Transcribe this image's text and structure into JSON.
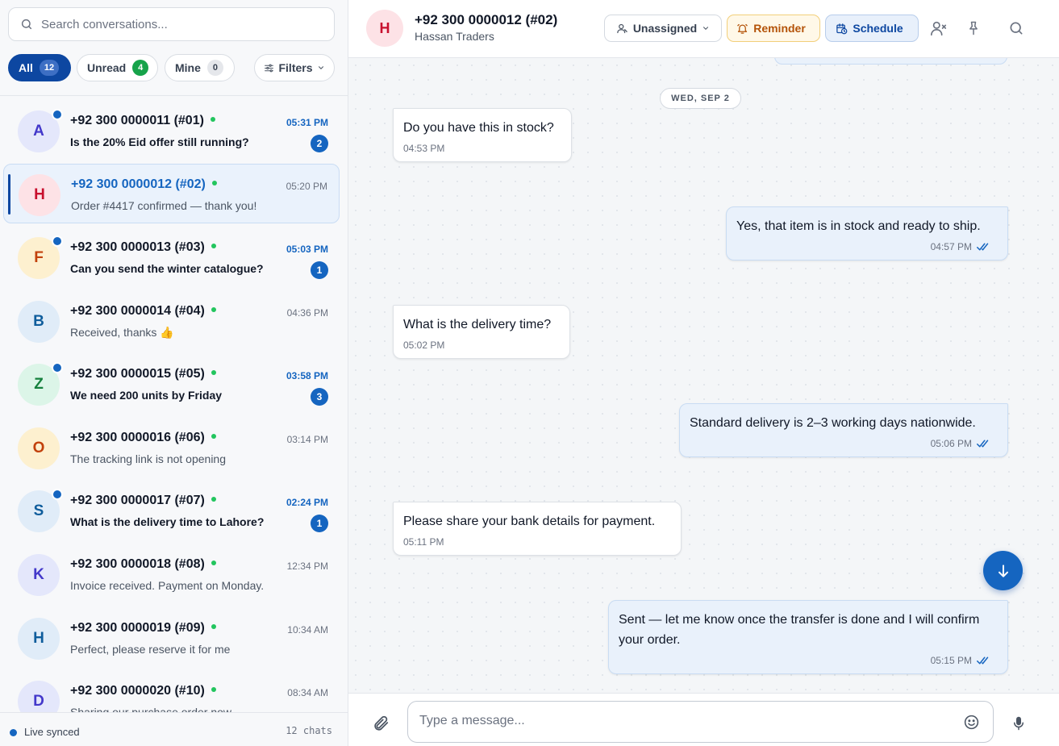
{
  "sidebar": {
    "search": {
      "placeholder": "Search conversations..."
    },
    "filters": {
      "all": {
        "label": "All",
        "count": "12"
      },
      "unread": {
        "label": "Unread",
        "count": "4"
      },
      "mine": {
        "label": "Mine",
        "count": "0"
      },
      "more": {
        "label": "Filters"
      }
    },
    "conversations": [
      {
        "initial": "A",
        "name": "+92 300 0000011 (#01)",
        "preview": "Is the 20% Eid offer still running?",
        "time": "05:31 PM",
        "unread_count": "2",
        "unread": true,
        "active": false,
        "avatar_bg": "#e4e7fb",
        "avatar_fg": "#4338ca"
      },
      {
        "initial": "H",
        "name": "+92 300 0000012 (#02)",
        "preview": "Order #4417 confirmed — thank you!",
        "time": "05:20 PM",
        "unread_count": "",
        "unread": false,
        "active": true,
        "avatar_bg": "#fde2e6",
        "avatar_fg": "#c8102e"
      },
      {
        "initial": "F",
        "name": "+92 300 0000013 (#03)",
        "preview": "Can you send the winter catalogue?",
        "time": "05:03 PM",
        "unread_count": "1",
        "unread": true,
        "active": false,
        "avatar_bg": "#fdf0cf",
        "avatar_fg": "#c2410c"
      },
      {
        "initial": "B",
        "name": "+92 300 0000014 (#04)",
        "preview": "Received, thanks 👍",
        "time": "04:36 PM",
        "unread_count": "",
        "unread": false,
        "active": false,
        "avatar_bg": "#e0ecf8",
        "avatar_fg": "#0f5d9c"
      },
      {
        "initial": "Z",
        "name": "+92 300 0000015 (#05)",
        "preview": "We need 200 units by Friday",
        "time": "03:58 PM",
        "unread_count": "3",
        "unread": true,
        "active": false,
        "avatar_bg": "#dcf5e8",
        "avatar_fg": "#15803d"
      },
      {
        "initial": "O",
        "name": "+92 300 0000016 (#06)",
        "preview": "The tracking link is not opening",
        "time": "03:14 PM",
        "unread_count": "",
        "unread": false,
        "active": false,
        "avatar_bg": "#fdf0cf",
        "avatar_fg": "#c2410c"
      },
      {
        "initial": "S",
        "name": "+92 300 0000017 (#07)",
        "preview": "What is the delivery time to Lahore?",
        "time": "02:24 PM",
        "unread_count": "1",
        "unread": true,
        "active": false,
        "avatar_bg": "#e0ecf8",
        "avatar_fg": "#0f5d9c"
      },
      {
        "initial": "K",
        "name": "+92 300 0000018 (#08)",
        "preview": "Invoice received. Payment on Monday.",
        "time": "12:34 PM",
        "unread_count": "",
        "unread": false,
        "active": false,
        "avatar_bg": "#e4e7fb",
        "avatar_fg": "#4338ca"
      },
      {
        "initial": "H",
        "name": "+92 300 0000019 (#09)",
        "preview": "Perfect, please reserve it for me",
        "time": "10:34 AM",
        "unread_count": "",
        "unread": false,
        "active": false,
        "avatar_bg": "#e0ecf8",
        "avatar_fg": "#0f5d9c"
      },
      {
        "initial": "D",
        "name": "+92 300 0000020 (#10)",
        "preview": "Sharing our purchase order now",
        "time": "08:34 AM",
        "unread_count": "",
        "unread": false,
        "active": false,
        "avatar_bg": "#e4e7fb",
        "avatar_fg": "#4338ca"
      }
    ],
    "footer": {
      "status": "Live synced",
      "count": "12 chats"
    }
  },
  "chat": {
    "header": {
      "initial": "H",
      "title": "+92 300 0000012 (#02)",
      "subtitle": "Hassan Traders",
      "assign_label": "Unassigned",
      "reminder_label": "Reminder",
      "schedule_label": "Schedule"
    },
    "date_separator": "WED, SEP 2",
    "messages": [
      {
        "direction": "in",
        "text": "Do you have this in stock?",
        "time": "04:53 PM"
      },
      {
        "direction": "out",
        "text": "Yes, that item is in stock and ready to ship.",
        "time": "04:57 PM"
      },
      {
        "direction": "in",
        "text": "What is the delivery time?",
        "time": "05:02 PM"
      },
      {
        "direction": "out",
        "text": "Standard delivery is 2–3 working days nationwide.",
        "time": "05:06 PM"
      },
      {
        "direction": "in",
        "text": "Please share your bank details for payment.",
        "time": "05:11 PM"
      },
      {
        "direction": "out",
        "text": "Sent — let me know once the transfer is done and I will confirm your order.",
        "time": "05:15 PM"
      }
    ],
    "composer": {
      "placeholder": "Type a message..."
    }
  },
  "colors": {
    "primary": "#0d47a1",
    "accent": "#1565c0",
    "online": "#22c55e",
    "reminder": "#b45309"
  },
  "icons": [
    "search-icon",
    "sliders-icon",
    "chevron-down-icon",
    "user-icon",
    "bell-icon",
    "calendar-clock-icon",
    "user-x-icon",
    "pin-icon",
    "double-check-icon",
    "arrow-down-icon",
    "paperclip-icon",
    "smile-icon",
    "microphone-icon"
  ]
}
